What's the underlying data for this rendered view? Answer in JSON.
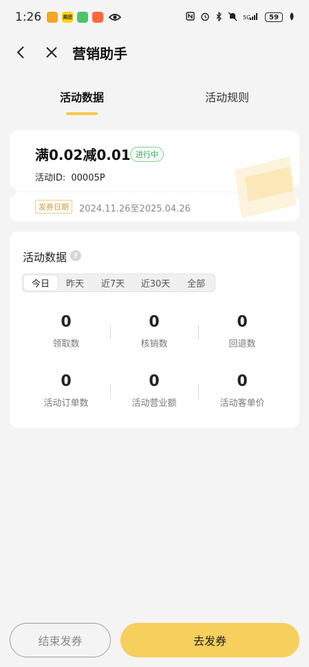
{
  "status_bar": {
    "time": "1:26",
    "app_icons": [
      "zoo-app-icon",
      "meituan-app-icon",
      "shield-app-icon",
      "game-app-icon"
    ],
    "app_icon_texts": [
      "",
      "美团",
      "",
      ""
    ],
    "signal_text": "5G",
    "battery": "59"
  },
  "nav": {
    "title": "营销助手"
  },
  "tabs": [
    {
      "label": "活动数据",
      "active": true
    },
    {
      "label": "活动规则",
      "active": false
    }
  ],
  "coupon": {
    "title": "满0.02减0.01",
    "status": "进行中",
    "id_label": "活动ID:",
    "id_value": "00005P",
    "date_label": "发券日期",
    "date_range": "2024.11.26至2025.04.26"
  },
  "data_section": {
    "title": "活动数据",
    "help_glyph": "?",
    "ranges": [
      {
        "label": "今日",
        "active": true
      },
      {
        "label": "昨天",
        "active": false
      },
      {
        "label": "近7天",
        "active": false
      },
      {
        "label": "近30天",
        "active": false
      },
      {
        "label": "全部",
        "active": false
      }
    ],
    "metrics": [
      {
        "value": "0",
        "label": "领取数"
      },
      {
        "value": "0",
        "label": "核销数"
      },
      {
        "value": "0",
        "label": "回退数"
      },
      {
        "value": "0",
        "label": "活动订单数"
      },
      {
        "value": "0",
        "label": "活动营业额"
      },
      {
        "value": "0",
        "label": "活动客单价"
      }
    ]
  },
  "actions": {
    "end_label": "结束发券",
    "issue_label": "去发券"
  },
  "colors": {
    "accent": "#f6cf5c",
    "badge_green": "#3bab5d",
    "date_tag": "#c9a655"
  }
}
